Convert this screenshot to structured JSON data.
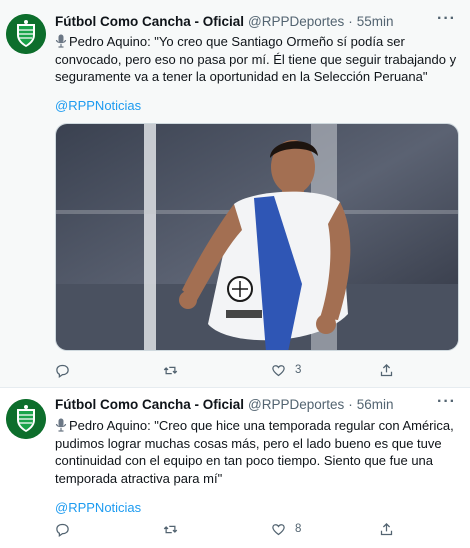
{
  "tweets": [
    {
      "author": {
        "name": "Fútbol Como Cancha - Oficial",
        "handle": "@RPPDeportes",
        "separator": "·",
        "time": "55min"
      },
      "text": "Pedro Aquino: \"Yo creo que Santiago Ormeño sí podía ser convocado, pero eso no pasa por mí. Él tiene que seguir trabajando y seguramente va a tener la oportunidad en la Selección Peruana\"",
      "mention": "@RPPNoticias",
      "has_media": true,
      "actions": {
        "reply": "",
        "retweet": "",
        "like": "3",
        "share": ""
      }
    },
    {
      "author": {
        "name": "Fútbol Como Cancha - Oficial",
        "handle": "@RPPDeportes",
        "separator": "·",
        "time": "56min"
      },
      "text": "Pedro Aquino: \"Creo que hice una temporada regular con América, pudimos lograr muchas cosas más, pero el lado bueno es que tuve continuidad con el equipo en tan poco tiempo. Siento que fue una temporada atractiva para mí\"",
      "mention": "@RPPNoticias",
      "has_media": false,
      "actions": {
        "reply": "",
        "retweet": "",
        "like": "8",
        "share": ""
      }
    }
  ],
  "icons": {
    "avatar": "club-crest-icon",
    "more": "more-options-icon",
    "mic": "microphone-icon",
    "reply": "reply-icon",
    "retweet": "retweet-icon",
    "like": "heart-icon",
    "share": "share-icon"
  },
  "colors": {
    "link": "#1d9bf0",
    "secondary_text": "#536471",
    "avatar_bg": "#0d6e2c"
  }
}
